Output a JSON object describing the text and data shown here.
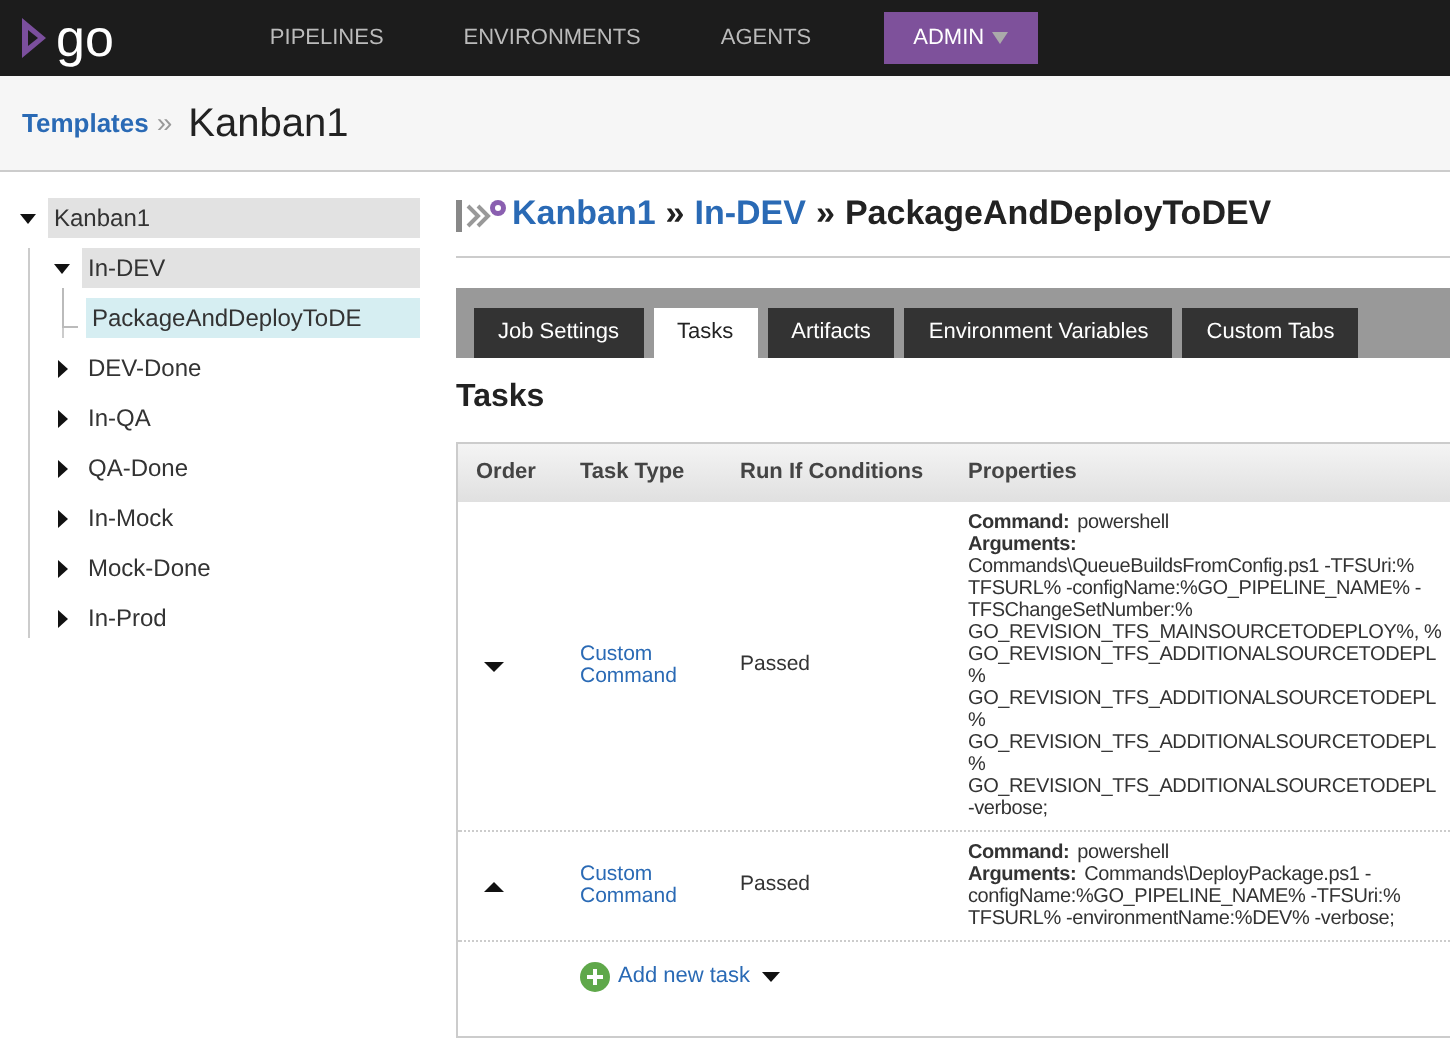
{
  "nav": {
    "logo": "go",
    "items": [
      {
        "label": "PIPELINES",
        "selected": false
      },
      {
        "label": "ENVIRONMENTS",
        "selected": false
      },
      {
        "label": "AGENTS",
        "selected": false
      },
      {
        "label": "ADMIN",
        "selected": true
      }
    ]
  },
  "breadcrumb": {
    "link": "Templates",
    "separator": "»",
    "current": "Kanban1"
  },
  "tree": [
    {
      "label": "Kanban1",
      "expanded": true,
      "selected": false,
      "children": [
        {
          "label": "In-DEV",
          "expanded": true,
          "selected": false,
          "children": [
            {
              "label": "PackageAndDeployToDE",
              "selected": true
            }
          ]
        },
        {
          "label": "DEV-Done",
          "expanded": false,
          "selected": false
        },
        {
          "label": "In-QA",
          "expanded": false,
          "selected": false
        },
        {
          "label": "QA-Done",
          "expanded": false,
          "selected": false
        },
        {
          "label": "In-Mock",
          "expanded": false,
          "selected": false
        },
        {
          "label": "Mock-Done",
          "expanded": false,
          "selected": false
        },
        {
          "label": "In-Prod",
          "expanded": false,
          "selected": false
        }
      ]
    }
  ],
  "job_title": {
    "template": "Kanban1",
    "separator_1": "»",
    "stage": "In-DEV",
    "separator_2": "»",
    "job": "PackageAndDeployToDEV"
  },
  "tabs": [
    {
      "label": "Job Settings",
      "selected": false
    },
    {
      "label": "Tasks",
      "selected": true
    },
    {
      "label": "Artifacts",
      "selected": false
    },
    {
      "label": "Environment Variables",
      "selected": false
    },
    {
      "label": "Custom Tabs",
      "selected": false
    }
  ],
  "section_title": "Tasks",
  "table": {
    "columns": [
      "Order",
      "Task Type",
      "Run If Conditions",
      "Properties"
    ],
    "rows": [
      {
        "kind": "move-down",
        "task_type": [
          "Custom",
          "Command"
        ],
        "run_if": "Passed",
        "command_label": "Command:",
        "command": "powershell",
        "arguments_label": "Arguments:",
        "arguments_inline": false,
        "arguments": [
          "Commands\\QueueBuildsFromConfig.ps1 -TFSUri:%",
          "TFSURL% -configName:%GO_PIPELINE_NAME% -",
          "TFSChangeSetNumber:%",
          "GO_REVISION_TFS_MAINSOURCETODEPLOY%, %",
          "GO_REVISION_TFS_ADDITIONALSOURCETODEPL",
          "%",
          "GO_REVISION_TFS_ADDITIONALSOURCETODEPL",
          "%",
          "GO_REVISION_TFS_ADDITIONALSOURCETODEPL",
          "%",
          "GO_REVISION_TFS_ADDITIONALSOURCETODEPL",
          "-verbose;"
        ]
      },
      {
        "kind": "move-up",
        "task_type": [
          "Custom",
          "Command"
        ],
        "run_if": "Passed",
        "command_label": "Command:",
        "command": "powershell",
        "arguments_label": "Arguments:",
        "arguments_inline": true,
        "arguments": [
          "Commands\\DeployPackage.ps1 -",
          "configName:%GO_PIPELINE_NAME% -TFSUri:%",
          "TFSURL% -environmentName:%DEV% -verbose;"
        ]
      }
    ],
    "add_task": "Add new task"
  }
}
